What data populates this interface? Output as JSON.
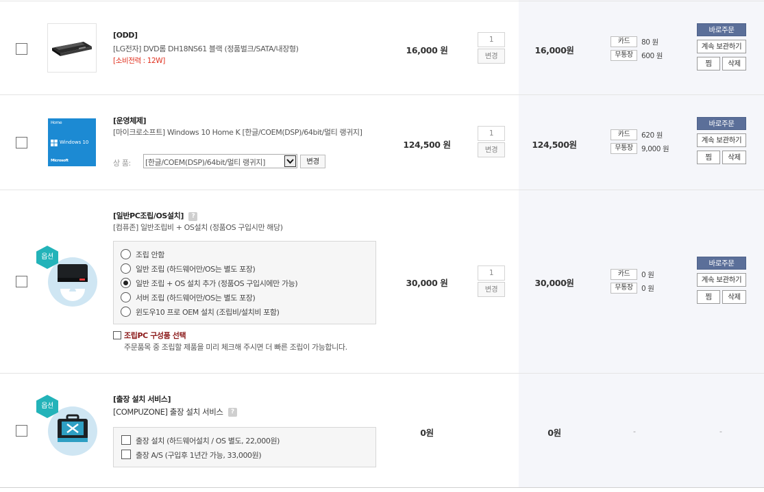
{
  "items": [
    {
      "title": "[ODD]",
      "desc": "[LG전자] DVD롬 DH18NS61 블랙 (정품벌크/SATA/내장형)",
      "power": "[소비전력 : 12W]",
      "price": "16,000 원",
      "qty": "1",
      "change": "변경",
      "total": "16,000원",
      "card_label": "카드",
      "card_point": "80 원",
      "cash_label": "무통장",
      "cash_point": "600 원",
      "order": "바로주문",
      "keep": "계속 보관하기",
      "wish": "찜",
      "delete": "삭제"
    },
    {
      "title": "[운영체제]",
      "desc": "[마이크로소프트] Windows 10 Home K [한글/COEM(DSP)/64bit/멀티 랭귀지]",
      "option_label": "상   품:",
      "option_value": "[한글/COEM(DSP)/64bit/멀티 랭귀지]",
      "option_change": "변경",
      "thumb_home": "Home",
      "thumb_title": "Windows 10",
      "thumb_brand": "Microsoft",
      "price": "124,500 원",
      "qty": "1",
      "change": "변경",
      "total": "124,500원",
      "card_label": "카드",
      "card_point": "620 원",
      "cash_label": "무통장",
      "cash_point": "9,000 원",
      "order": "바로주문",
      "keep": "계속 보관하기",
      "wish": "찜",
      "delete": "삭제"
    },
    {
      "badge": "옵션",
      "title": "[일반PC조립/OS설치]",
      "help": "?",
      "desc": "[컴퓨존] 일반조립비 + OS설치 (정품OS 구입시만 해당)",
      "options": [
        {
          "label": "조립 안함",
          "selected": false
        },
        {
          "label": "일반 조립 (하드웨어만/OS는 별도 포장)",
          "selected": false
        },
        {
          "label": "일반 조립 + OS 설치 추가 (정품OS 구입시에만 가능)",
          "selected": true
        },
        {
          "label": "서버 조립 (하드웨어만/OS는 별도 포장)",
          "selected": false
        },
        {
          "label": "윈도우10 프로 OEM 설치 (조립비/설치비 포함)",
          "selected": false
        }
      ],
      "select_parts": "조립PC 구성품 선택",
      "select_note": "주문품목 중 조립할 제품을 미리 체크해 주시면 더 빠른 조립이 가능합니다.",
      "price": "30,000 원",
      "qty": "1",
      "change": "변경",
      "total": "30,000원",
      "card_label": "카드",
      "card_point": "0 원",
      "cash_label": "무통장",
      "cash_point": "0 원",
      "order": "바로주문",
      "keep": "계속 보관하기",
      "wish": "찜",
      "delete": "삭제"
    },
    {
      "badge": "옵션",
      "title": "[출장 설치 서비스]",
      "desc": "[COMPUZONE] 출장 설치 서비스",
      "help": "?",
      "options": [
        {
          "label": "출장 설치 (하드웨어설치 / OS 별도, 22,000원)"
        },
        {
          "label": "출장 A/S (구입후 1년간 가능, 33,000원)"
        }
      ],
      "price": "0원",
      "total": "0원",
      "point_dash": "-",
      "action_dash": "-"
    }
  ],
  "colors": {
    "accent_button": "#5b6f99",
    "badge": "#23b3b9",
    "power_text": "#e0301e",
    "parts_link": "#8b1a1a"
  }
}
